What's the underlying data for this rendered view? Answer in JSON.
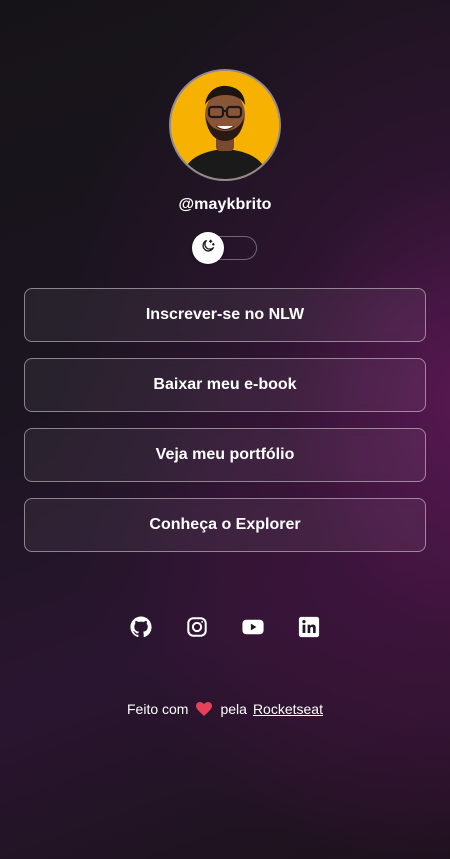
{
  "profile": {
    "avatar_alt": "Foto de Mayk Brito",
    "handle": "@maykbrito"
  },
  "theme_switch": {
    "icon": "moon-stars-icon",
    "state": "dark"
  },
  "links": [
    {
      "label": "Inscrever-se no NLW"
    },
    {
      "label": "Baixar meu e-book"
    },
    {
      "label": "Veja meu portfólio"
    },
    {
      "label": "Conheça o Explorer"
    }
  ],
  "social": [
    {
      "icon": "github-icon"
    },
    {
      "icon": "instagram-icon"
    },
    {
      "icon": "youtube-icon"
    },
    {
      "icon": "linkedin-icon"
    }
  ],
  "footer": {
    "prefix": "Feito com",
    "heart_icon": "heart-icon",
    "middle": "pela",
    "link_text": "Rocketseat"
  },
  "colors": {
    "avatar_background": "#f7b100",
    "heart": "#e83f5b"
  }
}
